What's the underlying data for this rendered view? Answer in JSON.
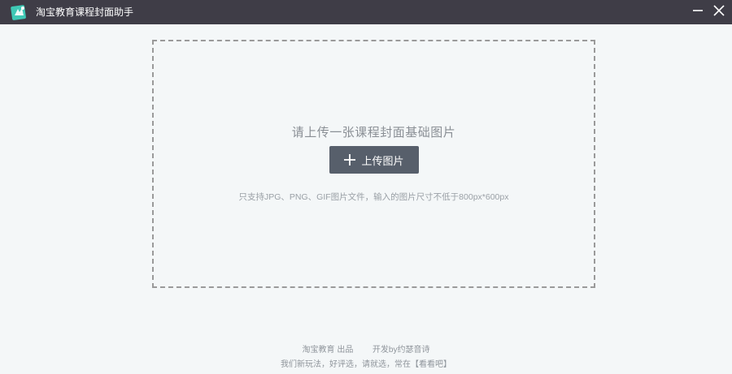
{
  "window": {
    "title": "淘宝教育课程封面助手",
    "logo_icon": "app-logo-icon",
    "minimize_icon": "minimize-icon",
    "close_icon": "close-icon"
  },
  "upload": {
    "prompt": "请上传一张课程封面基础图片",
    "button_label": "上传图片",
    "button_icon": "plus-icon",
    "hint": "只支持JPG、PNG、GIF图片文件，输入的图片尺寸不低于800px*600px"
  },
  "footer": {
    "producer": "淘宝教育 出品",
    "developer": "开发by约瑟音诗",
    "tagline_prefix": "我们新玩法，好评选，请就选，常在",
    "tagline_link": "【看看吧】"
  },
  "colors": {
    "titlebar_bg": "#3f3d47",
    "page_bg": "#f4f7f8",
    "button_bg": "#575f6b",
    "dashed_border": "#9a9a9a",
    "logo_teal": "#3fc8b5"
  }
}
